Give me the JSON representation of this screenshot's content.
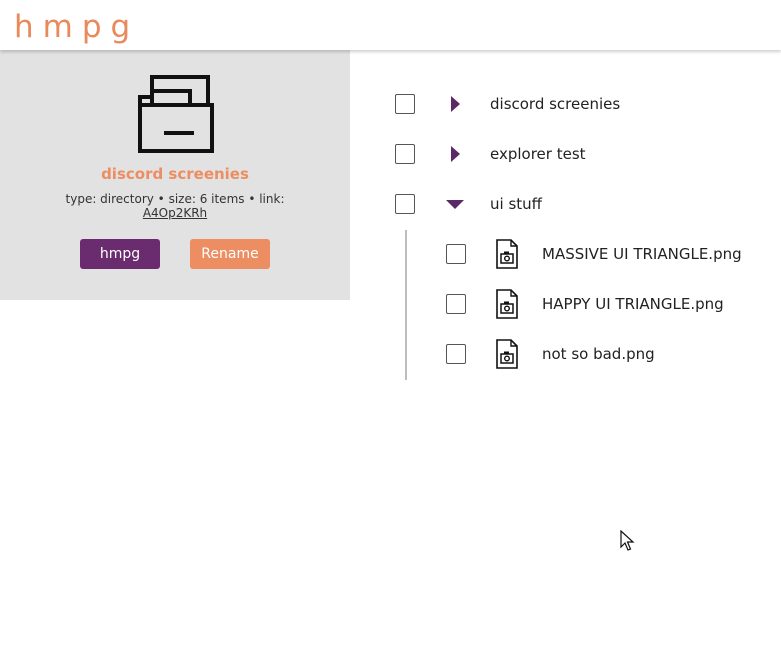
{
  "app": {
    "logo_text": "hmpg",
    "accent": "#ec8d62",
    "brand": "#6a2c6f"
  },
  "info_panel": {
    "icon": "folder-stack-icon",
    "name": "discord screenies",
    "meta_text": "type: directory • size: 6 items • link:",
    "link_text": "A4Op2KRh",
    "owner_button": "hmpg",
    "rename_button": "Rename"
  },
  "tree": {
    "folders": [
      {
        "label": "discord screenies",
        "state": "collapsed"
      },
      {
        "label": "explorer test",
        "state": "collapsed"
      },
      {
        "label": "ui stuff",
        "state": "expanded"
      }
    ],
    "children": [
      {
        "label": "MASSIVE UI TRIANGLE.png",
        "icon": "image-file-icon"
      },
      {
        "label": "HAPPY UI TRIANGLE.png",
        "icon": "image-file-icon"
      },
      {
        "label": "not so bad.png",
        "icon": "image-file-icon"
      }
    ]
  }
}
